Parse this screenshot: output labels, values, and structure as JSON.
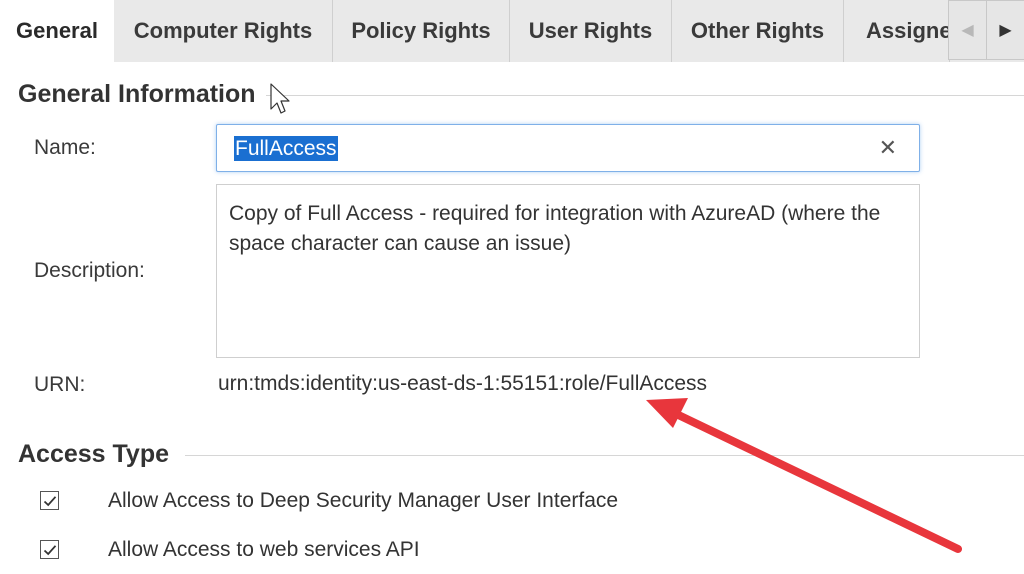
{
  "tabs": [
    {
      "label": "General",
      "active": true
    },
    {
      "label": "Computer Rights"
    },
    {
      "label": "Policy Rights"
    },
    {
      "label": "User Rights"
    },
    {
      "label": "Other Rights"
    },
    {
      "label": "Assigne"
    }
  ],
  "tab_scroll": {
    "left_icon": "caret-left-icon",
    "right_icon": "caret-right-icon"
  },
  "general_info": {
    "title": "General Information",
    "name_label": "Name:",
    "name_value": "FullAccess",
    "description_label": "Description:",
    "description_value": "Copy of Full Access - required for integration with AzureAD (where the space character can cause an issue)",
    "urn_label": "URN:",
    "urn_value": "urn:tmds:identity:us-east-ds-1:55151:role/FullAccess"
  },
  "access_type": {
    "title": "Access Type",
    "options": [
      {
        "label": "Allow Access to Deep Security Manager User Interface",
        "checked": true
      },
      {
        "label": "Allow Access to web services API",
        "checked": true
      }
    ]
  },
  "annotation": {
    "arrow_color": "#e8363c"
  },
  "colors": {
    "selection": "#1a6fd1",
    "focus_border": "#7fb0e8",
    "tab_bar": "#e9e9e9"
  }
}
